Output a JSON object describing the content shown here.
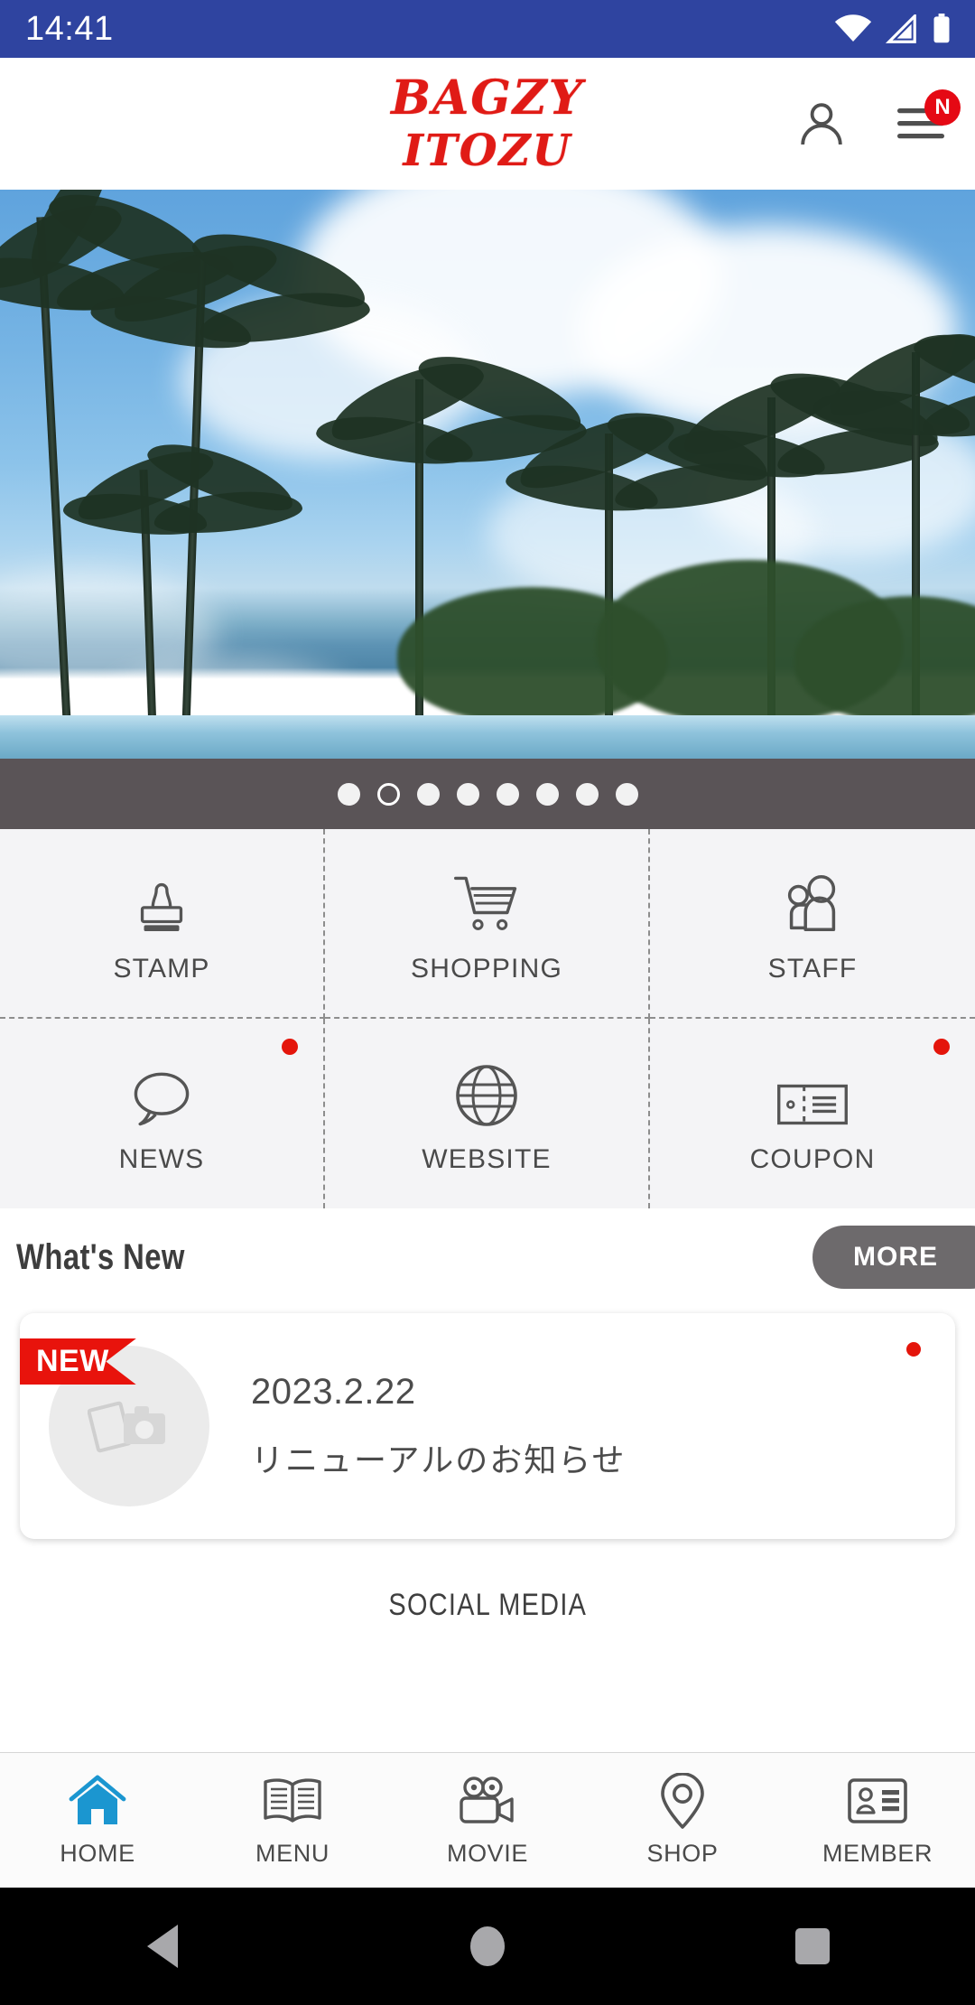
{
  "status_bar": {
    "time": "14:41",
    "icons": [
      "wifi-icon",
      "cellular-signal-icon",
      "battery-icon"
    ],
    "background_color": "#2f44a0"
  },
  "header": {
    "logo_line1": "BAGZY",
    "logo_line2": "ITOZU",
    "logo_color": "#e01b16",
    "account_icon": "person-icon",
    "menu_icon": "hamburger-menu-icon",
    "menu_badge": "N",
    "badge_color": "#e50914"
  },
  "hero": {
    "alt": "tropical beach with palm trees and blue sky",
    "slide_count": 8,
    "active_slide": 2
  },
  "menu_grid": {
    "items": [
      {
        "label": "STAMP",
        "icon": "stamp-icon",
        "has_dot": false
      },
      {
        "label": "SHOPPING",
        "icon": "shopping-cart-icon",
        "has_dot": false
      },
      {
        "label": "STAFF",
        "icon": "staff-people-icon",
        "has_dot": false
      },
      {
        "label": "NEWS",
        "icon": "speech-bubble-icon",
        "has_dot": true
      },
      {
        "label": "WEBSITE",
        "icon": "globe-icon",
        "has_dot": false
      },
      {
        "label": "COUPON",
        "icon": "ticket-icon",
        "has_dot": true
      }
    ],
    "dot_color": "#e4150b"
  },
  "whats_new": {
    "title": "What's New",
    "more_label": "MORE",
    "more_color": "#6d6a6c",
    "card": {
      "ribbon": "NEW",
      "ribbon_color": "#e8130c",
      "thumb_icon": "photo-placeholder-icon",
      "date": "2023.2.22",
      "title": "リニューアルのお知らせ",
      "has_dot": true
    }
  },
  "social_media": {
    "title": "SOCIAL MEDIA"
  },
  "tab_bar": {
    "active_color": "#1b96d0",
    "tabs": [
      {
        "label": "HOME",
        "icon": "home-icon",
        "active": true
      },
      {
        "label": "MENU",
        "icon": "open-book-icon",
        "active": false
      },
      {
        "label": "MOVIE",
        "icon": "video-camera-icon",
        "active": false
      },
      {
        "label": "SHOP",
        "icon": "map-pin-icon",
        "active": false
      },
      {
        "label": "MEMBER",
        "icon": "id-card-icon",
        "active": false
      }
    ]
  },
  "android_nav": {
    "back": "back-triangle-icon",
    "home": "home-circle-icon",
    "recents": "recents-square-icon"
  }
}
